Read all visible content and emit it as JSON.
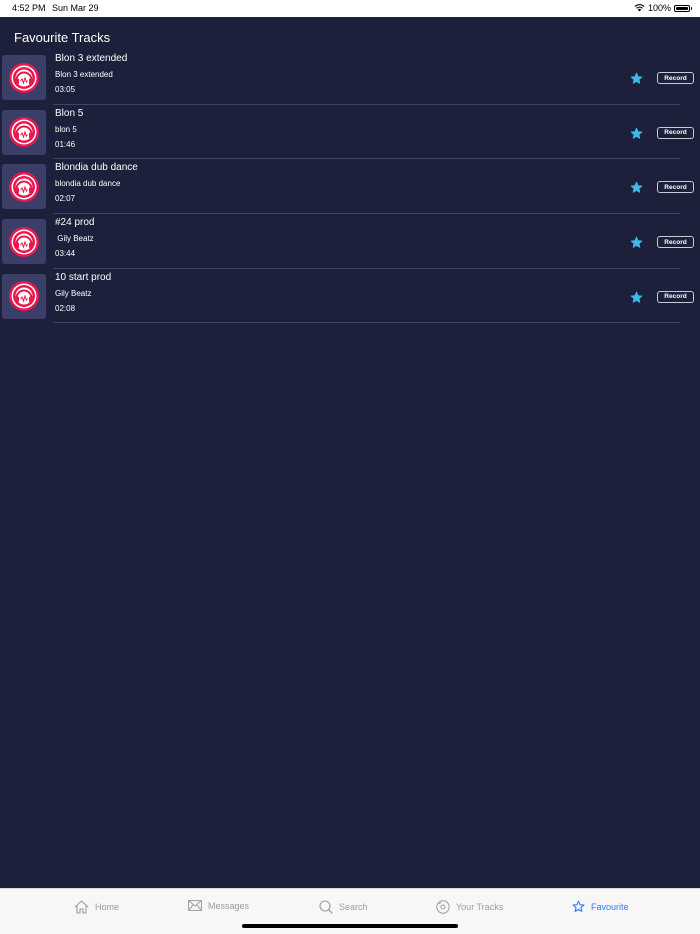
{
  "status_bar": {
    "time": "4:52 PM",
    "date": "Sun Mar 29",
    "battery": "100%"
  },
  "page": {
    "title": "Favourite Tracks"
  },
  "tracks": [
    {
      "title": "Blon 3 extended",
      "artist": "Blon 3 extended",
      "duration": "03:05",
      "record_label": "Record"
    },
    {
      "title": "Blon 5",
      "artist": "blon 5",
      "duration": "01:46",
      "record_label": "Record"
    },
    {
      "title": "Blondia dub dance",
      "artist": "blondia dub dance",
      "duration": "02:07",
      "record_label": "Record"
    },
    {
      "title": "#24 prod",
      "artist": " Gily Beatz",
      "duration": "03:44",
      "record_label": "Record"
    },
    {
      "title": "10 start prod",
      "artist": "Gily Beatz",
      "duration": "02:08",
      "record_label": "Record"
    }
  ],
  "tab_bar": {
    "tabs": [
      {
        "label": "Home",
        "icon": "home-icon"
      },
      {
        "label": "Messages",
        "icon": "envelope-icon"
      },
      {
        "label": "Search",
        "icon": "search-icon"
      },
      {
        "label": "Your Tracks",
        "icon": "disc-icon"
      },
      {
        "label": "Favourite",
        "icon": "star-outline-icon"
      }
    ],
    "active_tab": "Favourite"
  },
  "colors": {
    "background": "#1c203a",
    "thumbnail_bg": "#3b3f68",
    "star": "#3fb8ea",
    "active_tab": "#2f7cf6",
    "inactive_tab": "#9c9c9c"
  }
}
